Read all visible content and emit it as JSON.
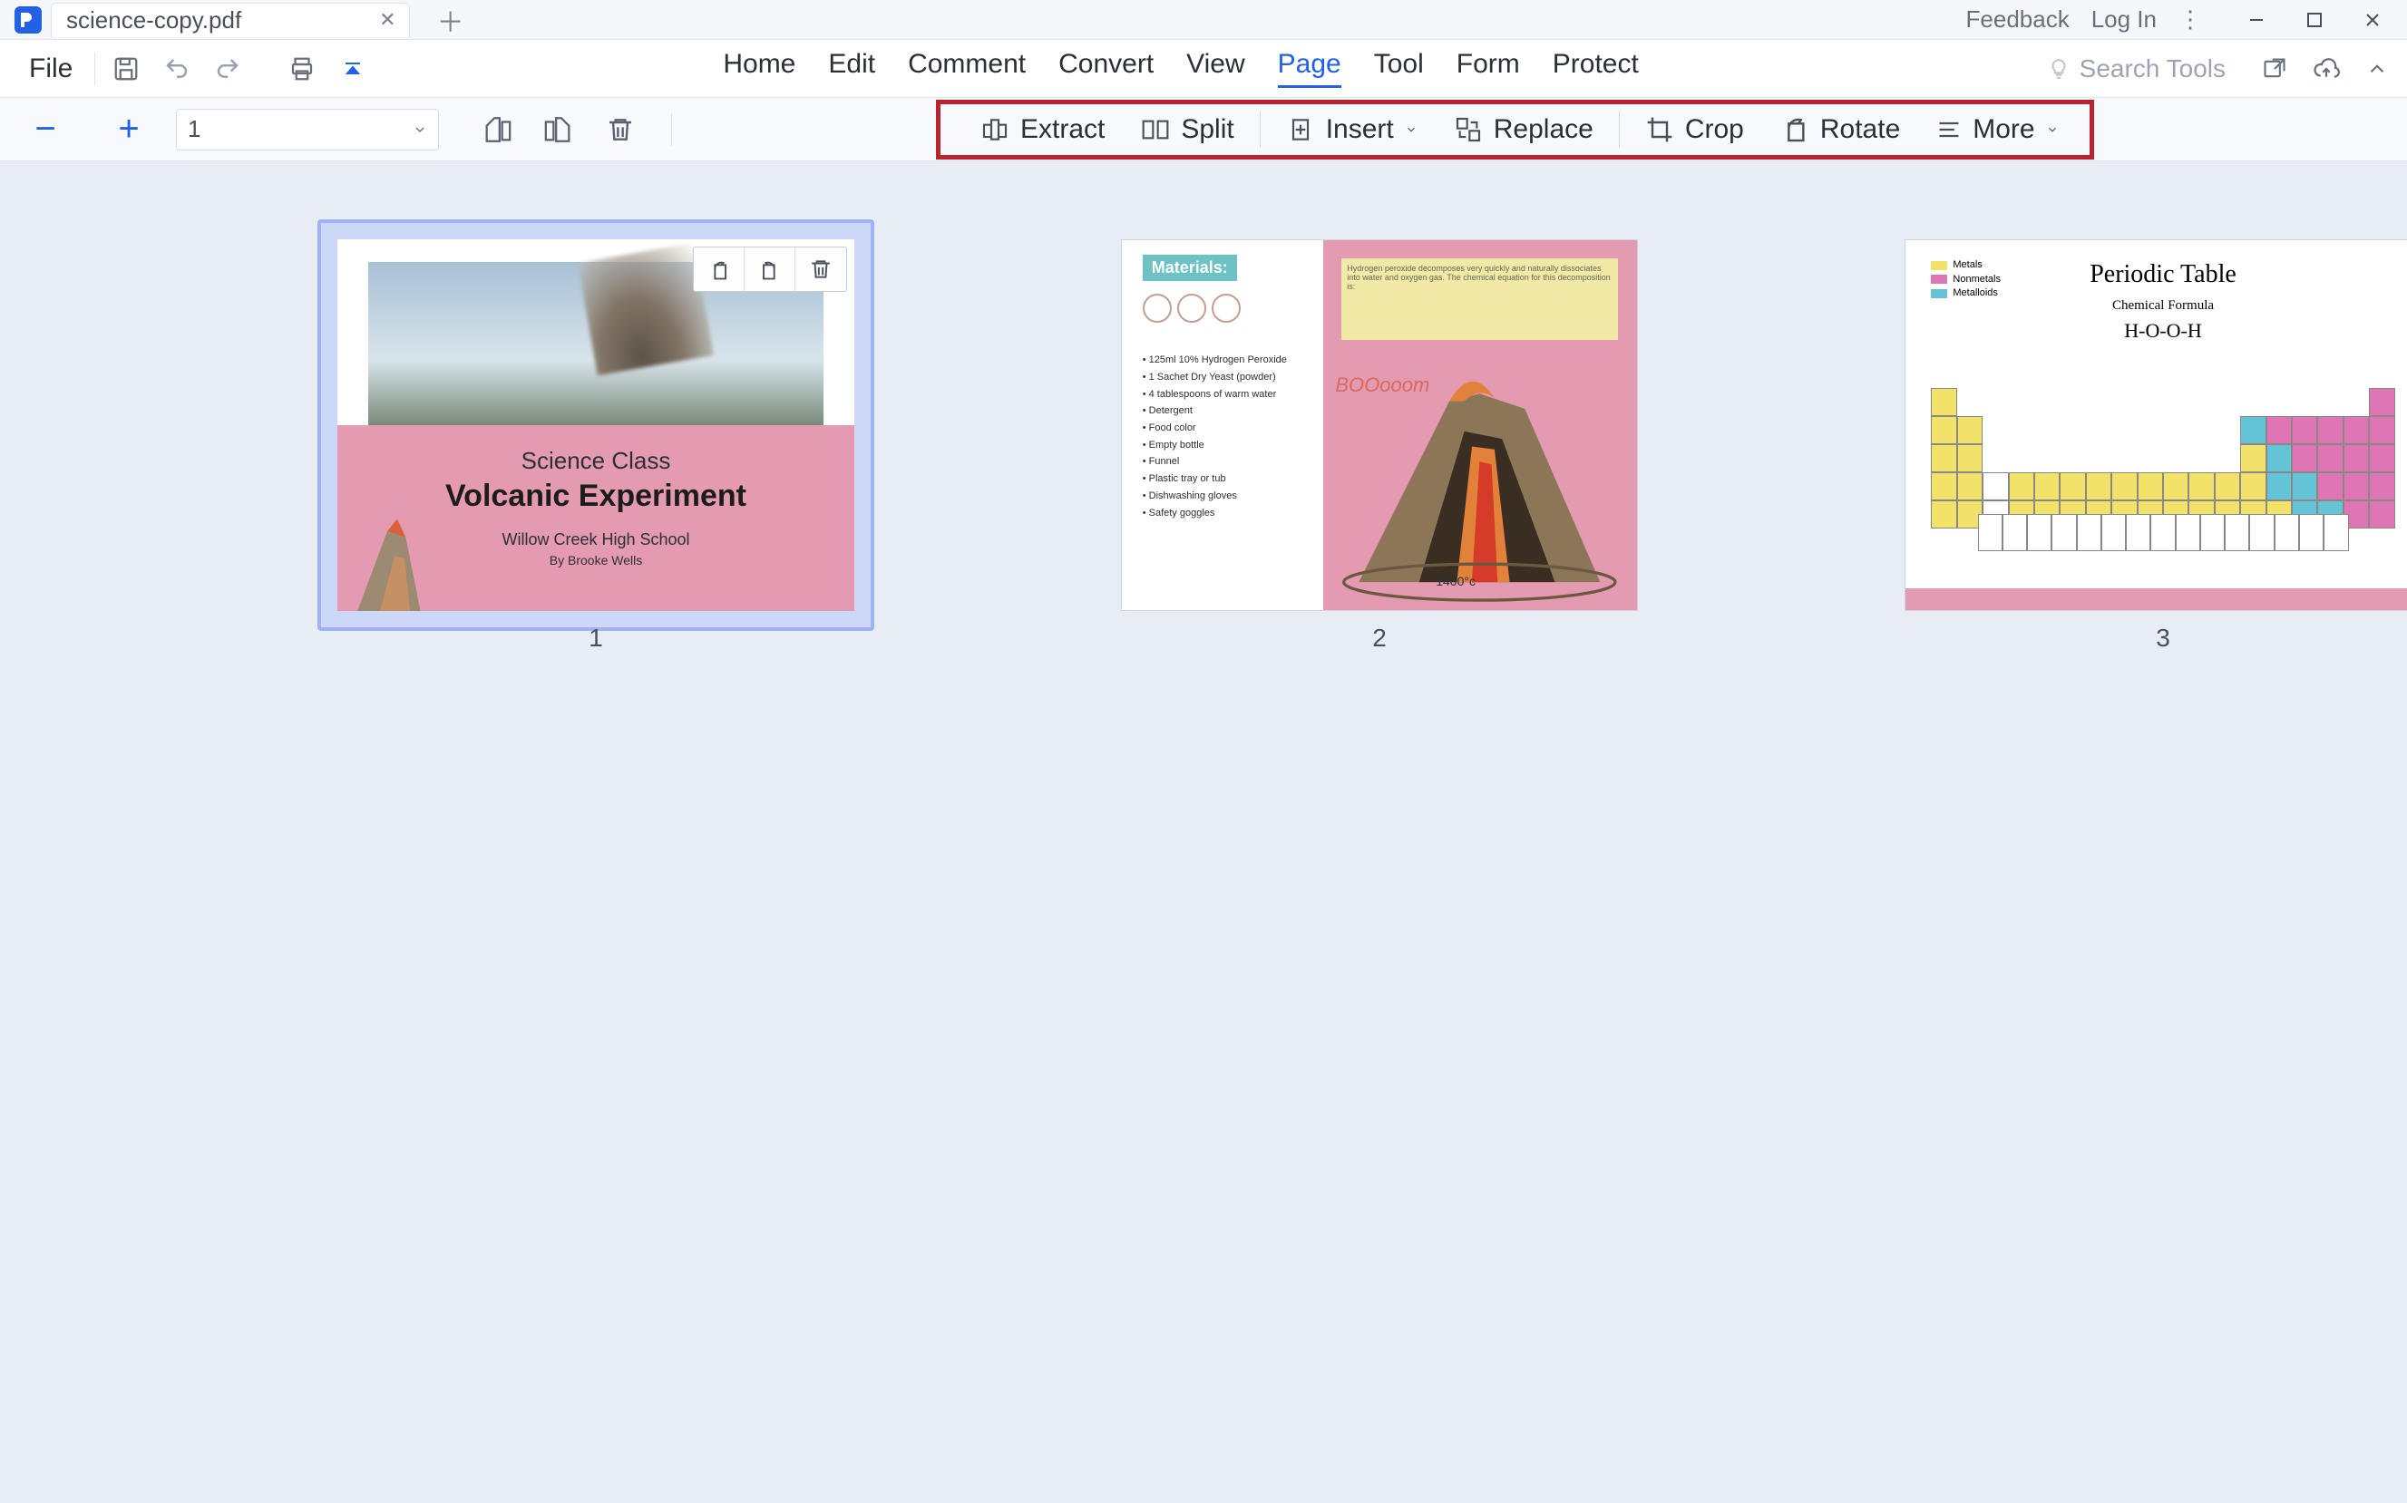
{
  "titlebar": {
    "tab_name": "science-copy.pdf",
    "feedback": "Feedback",
    "login": "Log In"
  },
  "menubar": {
    "file": "File",
    "items": [
      "Home",
      "Edit",
      "Comment",
      "Convert",
      "View",
      "Page",
      "Tool",
      "Form",
      "Protect"
    ],
    "active_index": 5,
    "search_placeholder": "Search Tools"
  },
  "toolrow": {
    "page_number": "1",
    "tools": {
      "extract": "Extract",
      "split": "Split",
      "insert": "Insert",
      "replace": "Replace",
      "crop": "Crop",
      "rotate": "Rotate",
      "more": "More"
    }
  },
  "pages": {
    "p1": {
      "num": "1",
      "title1": "Science Class",
      "title2": "Volcanic Experiment",
      "sub1": "Willow Creek High School",
      "sub2": "By Brooke Wells"
    },
    "p2": {
      "num": "2",
      "materials_label": "Materials:",
      "boom": "BOOooom",
      "temp": "1400°c",
      "list": [
        "125ml 10% Hydrogen Peroxide",
        "1 Sachet Dry Yeast (powder)",
        "4 tablespoons of warm water",
        "Detergent",
        "Food color",
        "Empty bottle",
        "Funnel",
        "Plastic tray or tub",
        "Dishwashing gloves",
        "Safety goggles"
      ]
    },
    "p3": {
      "num": "3",
      "title": "Periodic Table",
      "subtitle": "Chemical Formula",
      "formula": "H-O-O-H"
    }
  }
}
